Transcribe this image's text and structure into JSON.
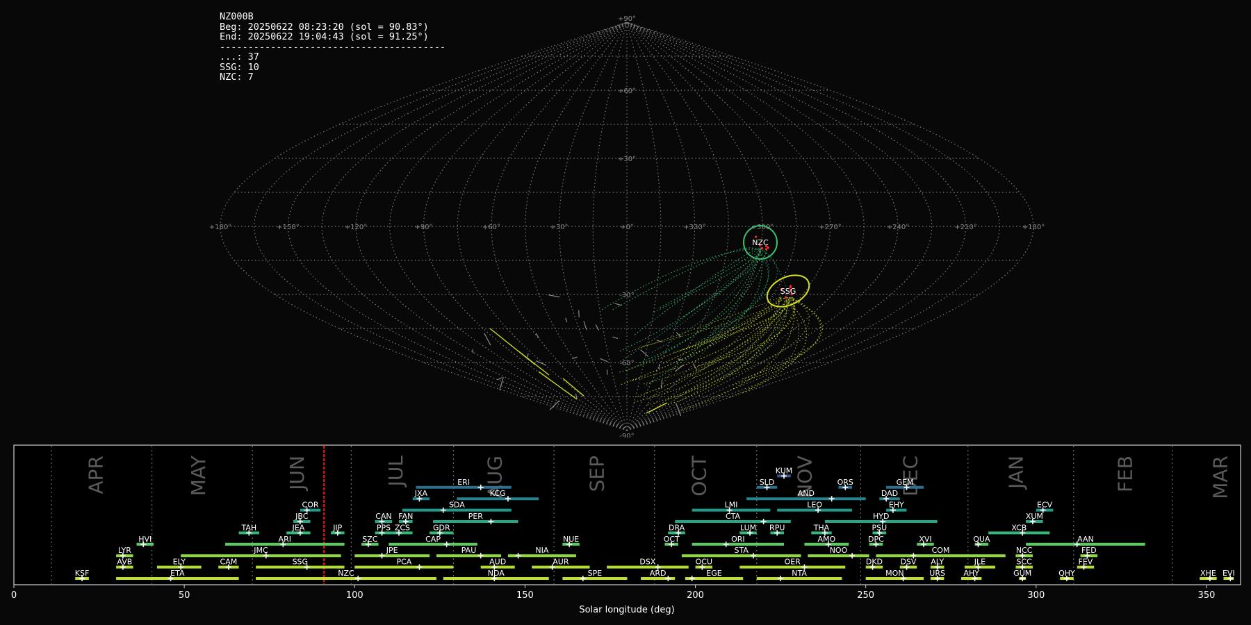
{
  "info": {
    "station": "NZ000B",
    "begin": "Beg: 20250622 08:23:20 (sol = 90.83°)",
    "end": "End: 20250622 19:04:43 (sol = 91.25°)",
    "separator": "----------------------------------------",
    "counts": [
      "...: 37",
      "SSG: 10",
      "NZC: 7"
    ]
  },
  "sky_map": {
    "projection": "sinusoidal",
    "lon_labels": [
      "+180°",
      "+150°",
      "+120°",
      "+90°",
      "+60°",
      "+30°",
      "+0°",
      "+330°",
      "+300°",
      "+270°",
      "+240°",
      "+210°",
      "+180°"
    ],
    "lat_labels": [
      "+90°",
      "+60°",
      "+30°",
      "-30°",
      "-60°",
      "-90°"
    ],
    "radiants": [
      {
        "code": "NZC",
        "lon": 300,
        "lat": -5,
        "color": "#3fbf73"
      },
      {
        "code": "SSG",
        "lon": 288,
        "lat": -20,
        "color": "#d7e21f"
      }
    ]
  },
  "chart_data": {
    "type": "gantt",
    "xlabel": "Solar longitude (deg)",
    "xlim": [
      0,
      360
    ],
    "xticks": [
      0,
      50,
      100,
      150,
      200,
      250,
      300,
      350
    ],
    "current_sol": 91.0,
    "months": [
      {
        "label": "APR",
        "pos": 24
      },
      {
        "label": "MAY",
        "pos": 54
      },
      {
        "label": "JUN",
        "pos": 83
      },
      {
        "label": "JUL",
        "pos": 112
      },
      {
        "label": "AUG",
        "pos": 141
      },
      {
        "label": "SEP",
        "pos": 171
      },
      {
        "label": "OCT",
        "pos": 201
      },
      {
        "label": "NOV",
        "pos": 232
      },
      {
        "label": "DEC",
        "pos": 263
      },
      {
        "label": "JAN",
        "pos": 294
      },
      {
        "label": "FEB",
        "pos": 326
      },
      {
        "label": "MAR",
        "pos": 354
      }
    ],
    "month_boundaries": [
      11,
      40.5,
      70,
      99,
      129,
      158.5,
      188,
      218,
      248.5,
      280,
      311,
      340
    ],
    "colors": [
      "#c2df23",
      "#b0dd2f",
      "#8fd744",
      "#5ec962",
      "#35b779",
      "#22a884",
      "#1f9a8a",
      "#26828e",
      "#2e6e8e",
      "#3b528b",
      "#472d7b"
    ],
    "showers": [
      {
        "code": "KSF",
        "start": 18,
        "end": 22,
        "peak": 20,
        "row": 0
      },
      {
        "code": "ETA",
        "start": 30,
        "end": 66,
        "peak": 46,
        "row": 0
      },
      {
        "code": "NZC",
        "start": 71,
        "end": 124,
        "peak": 101,
        "row": 0
      },
      {
        "code": "NDA",
        "start": 126,
        "end": 157,
        "peak": 141,
        "row": 0
      },
      {
        "code": "SPE",
        "start": 161,
        "end": 180,
        "peak": 167,
        "row": 0
      },
      {
        "code": "ARD",
        "start": 184,
        "end": 194,
        "peak": 192,
        "row": 0
      },
      {
        "code": "EGE",
        "start": 197,
        "end": 214,
        "peak": 199,
        "row": 0
      },
      {
        "code": "NTA",
        "start": 218,
        "end": 243,
        "peak": 225,
        "row": 0
      },
      {
        "code": "MON",
        "start": 250,
        "end": 267,
        "peak": 261,
        "row": 0
      },
      {
        "code": "URS",
        "start": 269,
        "end": 273,
        "peak": 271,
        "row": 0
      },
      {
        "code": "AHY",
        "start": 278,
        "end": 284,
        "peak": 282,
        "row": 0
      },
      {
        "code": "GUM",
        "start": 295,
        "end": 297,
        "peak": 296,
        "row": 0
      },
      {
        "code": "QHY",
        "start": 307,
        "end": 311,
        "peak": 309,
        "row": 0
      },
      {
        "code": "XHE",
        "start": 348,
        "end": 353,
        "peak": 351,
        "row": 0
      },
      {
        "code": "EVI",
        "start": 355,
        "end": 358,
        "peak": 357,
        "row": 0
      },
      {
        "code": "AVB",
        "start": 30,
        "end": 35,
        "peak": 32,
        "row": 1
      },
      {
        "code": "ELY",
        "start": 42,
        "end": 55,
        "peak": 49,
        "row": 1
      },
      {
        "code": "CAM",
        "start": 60,
        "end": 66,
        "peak": 63,
        "row": 1
      },
      {
        "code": "SSG",
        "start": 71,
        "end": 97,
        "peak": 86,
        "row": 1
      },
      {
        "code": "PCA",
        "start": 100,
        "end": 129,
        "peak": 119,
        "row": 1
      },
      {
        "code": "AUD",
        "start": 137,
        "end": 147,
        "peak": 141,
        "row": 1
      },
      {
        "code": "AUR",
        "start": 152,
        "end": 169,
        "peak": 158,
        "row": 1
      },
      {
        "code": "DSX",
        "start": 174,
        "end": 198,
        "peak": 189,
        "row": 1
      },
      {
        "code": "OCU",
        "start": 200,
        "end": 205,
        "peak": 202,
        "row": 1
      },
      {
        "code": "OER",
        "start": 213,
        "end": 244,
        "peak": 232,
        "row": 1
      },
      {
        "code": "DKD",
        "start": 250,
        "end": 255,
        "peak": 252,
        "row": 1
      },
      {
        "code": "DSV",
        "start": 260,
        "end": 265,
        "peak": 262,
        "row": 1
      },
      {
        "code": "ALY",
        "start": 269,
        "end": 273,
        "peak": 271,
        "row": 1
      },
      {
        "code": "JLE",
        "start": 279,
        "end": 288,
        "peak": 283,
        "row": 1
      },
      {
        "code": "SCC",
        "start": 294,
        "end": 299,
        "peak": 296,
        "row": 1
      },
      {
        "code": "FEV",
        "start": 312,
        "end": 317,
        "peak": 314,
        "row": 1
      },
      {
        "code": "LYR",
        "start": 30,
        "end": 35,
        "peak": 32,
        "row": 2
      },
      {
        "code": "JMC",
        "start": 49,
        "end": 96,
        "peak": 74,
        "row": 2
      },
      {
        "code": "JPE",
        "start": 100,
        "end": 122,
        "peak": 108,
        "row": 2
      },
      {
        "code": "PAU",
        "start": 124,
        "end": 143,
        "peak": 137,
        "row": 2
      },
      {
        "code": "NIA",
        "start": 145,
        "end": 165,
        "peak": 148,
        "row": 2
      },
      {
        "code": "STA",
        "start": 196,
        "end": 231,
        "peak": 217,
        "row": 2
      },
      {
        "code": "NOO",
        "start": 233,
        "end": 251,
        "peak": 246,
        "row": 2
      },
      {
        "code": "COM",
        "start": 253,
        "end": 291,
        "peak": 264,
        "row": 2
      },
      {
        "code": "NCC",
        "start": 294,
        "end": 299,
        "peak": 296,
        "row": 2
      },
      {
        "code": "FED",
        "start": 313,
        "end": 318,
        "peak": 315,
        "row": 2
      },
      {
        "code": "HVI",
        "start": 36,
        "end": 41,
        "peak": 38,
        "row": 3
      },
      {
        "code": "ARI",
        "start": 62,
        "end": 97,
        "peak": 79,
        "row": 3
      },
      {
        "code": "SZC",
        "start": 102,
        "end": 107,
        "peak": 104,
        "row": 3
      },
      {
        "code": "CAP",
        "start": 110,
        "end": 136,
        "peak": 127,
        "row": 3
      },
      {
        "code": "NUE",
        "start": 161,
        "end": 166,
        "peak": 163,
        "row": 3
      },
      {
        "code": "OCT",
        "start": 191,
        "end": 195,
        "peak": 193,
        "row": 3
      },
      {
        "code": "ORI",
        "start": 199,
        "end": 226,
        "peak": 209,
        "row": 3
      },
      {
        "code": "AMO",
        "start": 232,
        "end": 245,
        "peak": 239,
        "row": 3
      },
      {
        "code": "DPC",
        "start": 251,
        "end": 255,
        "peak": 253,
        "row": 3
      },
      {
        "code": "XVI",
        "start": 265,
        "end": 270,
        "peak": 267,
        "row": 3
      },
      {
        "code": "QUA",
        "start": 282,
        "end": 286,
        "peak": 283,
        "row": 3
      },
      {
        "code": "AAN",
        "start": 297,
        "end": 332,
        "peak": 312,
        "row": 3
      },
      {
        "code": "TAH",
        "start": 66,
        "end": 72,
        "peak": 69,
        "row": 4
      },
      {
        "code": "JEA",
        "start": 80,
        "end": 87,
        "peak": 84,
        "row": 4
      },
      {
        "code": "JIP",
        "start": 93,
        "end": 97,
        "peak": 95,
        "row": 4
      },
      {
        "code": "PPS",
        "start": 106,
        "end": 111,
        "peak": 108,
        "row": 4
      },
      {
        "code": "ZCS",
        "start": 111,
        "end": 117,
        "peak": 113,
        "row": 4
      },
      {
        "code": "GDR",
        "start": 122,
        "end": 129,
        "peak": 125,
        "row": 4
      },
      {
        "code": "DRA",
        "start": 192,
        "end": 197,
        "peak": 195,
        "row": 4
      },
      {
        "code": "LUM",
        "start": 213,
        "end": 218,
        "peak": 216,
        "row": 4
      },
      {
        "code": "RPU",
        "start": 222,
        "end": 226,
        "peak": 224,
        "row": 4
      },
      {
        "code": "THA",
        "start": 234,
        "end": 240,
        "peak": 238,
        "row": 4
      },
      {
        "code": "PSU",
        "start": 252,
        "end": 256,
        "peak": 254,
        "row": 4
      },
      {
        "code": "XCB",
        "start": 286,
        "end": 304,
        "peak": 296,
        "row": 4
      },
      {
        "code": "JBC",
        "start": 82,
        "end": 87,
        "peak": 84,
        "row": 5
      },
      {
        "code": "CAN",
        "start": 106,
        "end": 111,
        "peak": 108,
        "row": 5
      },
      {
        "code": "FAN",
        "start": 113,
        "end": 117,
        "peak": 115,
        "row": 5
      },
      {
        "code": "PER",
        "start": 123,
        "end": 148,
        "peak": 140,
        "row": 5
      },
      {
        "code": "CTA",
        "start": 194,
        "end": 228,
        "peak": 220,
        "row": 5
      },
      {
        "code": "HYD",
        "start": 238,
        "end": 271,
        "peak": 255,
        "row": 5
      },
      {
        "code": "XUM",
        "start": 297,
        "end": 302,
        "peak": 299,
        "row": 5
      },
      {
        "code": "COR",
        "start": 84,
        "end": 90,
        "peak": 86,
        "row": 6
      },
      {
        "code": "SDA",
        "start": 114,
        "end": 146,
        "peak": 126,
        "row": 6
      },
      {
        "code": "LMI",
        "start": 199,
        "end": 222,
        "peak": 210,
        "row": 6
      },
      {
        "code": "LEO",
        "start": 224,
        "end": 246,
        "peak": 236,
        "row": 6
      },
      {
        "code": "EHY",
        "start": 256,
        "end": 262,
        "peak": 258,
        "row": 6
      },
      {
        "code": "ECV",
        "start": 300,
        "end": 305,
        "peak": 302,
        "row": 6
      },
      {
        "code": "JXA",
        "start": 117,
        "end": 122,
        "peak": 119,
        "row": 7
      },
      {
        "code": "KCG",
        "start": 130,
        "end": 154,
        "peak": 145,
        "row": 7
      },
      {
        "code": "AND",
        "start": 215,
        "end": 250,
        "peak": 240,
        "row": 7
      },
      {
        "code": "DAD",
        "start": 254,
        "end": 260,
        "peak": 256,
        "row": 7
      },
      {
        "code": "ERI",
        "start": 118,
        "end": 146,
        "peak": 137,
        "row": 8
      },
      {
        "code": "SLD",
        "start": 218,
        "end": 224,
        "peak": 221,
        "row": 8
      },
      {
        "code": "ORS",
        "start": 242,
        "end": 246,
        "peak": 244,
        "row": 8
      },
      {
        "code": "GEM",
        "start": 256,
        "end": 267,
        "peak": 262,
        "row": 8
      },
      {
        "code": "KUM",
        "start": 224,
        "end": 228,
        "peak": 226,
        "row": 9
      }
    ]
  }
}
